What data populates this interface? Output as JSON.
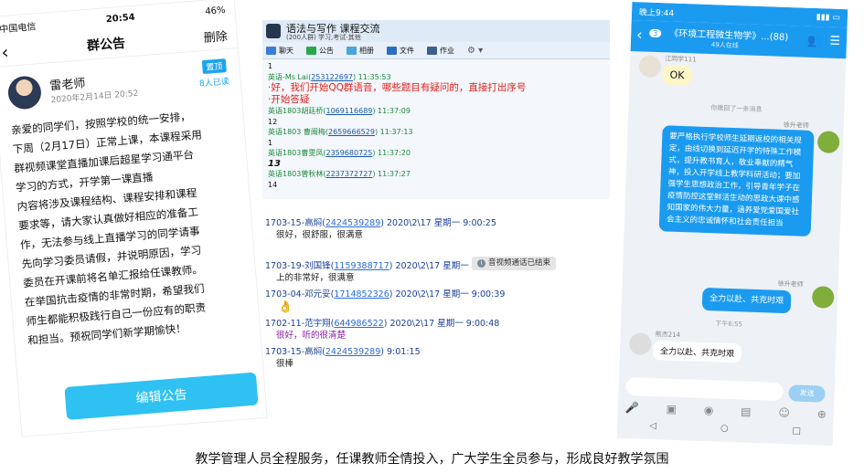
{
  "left_phone": {
    "status": {
      "carrier": "中国电信",
      "time": "20:54",
      "battery": "46%"
    },
    "header": {
      "title": "群公告",
      "delete_label": "删除"
    },
    "post": {
      "author": "雷老师",
      "date": "2020年2月14日 20:52",
      "pin_label": "置顶",
      "read_count": "8人已读",
      "lines": [
        "亲爱的同学们，按照学校的统一安排，",
        "下周（2月17日）正常上课，本课程采用",
        "群视频课堂直播加课后超星学习通平台",
        "学习的方式，开学第一课直播",
        "内容将涉及课程结构、课程安排和课程",
        "要求等，请大家认真做好相应的准备工",
        "作，无法参与线上直播学习的同学请事",
        "先向学习委员请假，并说明原因，学习",
        "委员在开课前将名单汇报给任课教师。",
        "在举国抗击疫情的非常时期，希望我们",
        "师生都能积极践行自己一份应有的职责",
        "和担当。预祝同学们新学期愉快！"
      ],
      "edit_button": "编辑公告"
    }
  },
  "qq_group": {
    "title": "语法与写作 课程交流",
    "subtitle": "(200人群) 学习,考试-其他",
    "toolbar": [
      "聊天",
      "公告",
      "相册",
      "文件",
      "作业"
    ],
    "messages": [
      {
        "type": "text",
        "text": "1"
      },
      {
        "type": "sender",
        "name": "英语-Ms Lai(",
        "id": "253122697",
        "time": ") 11:35:53"
      },
      {
        "type": "red",
        "text": "·好，我们开始QQ群语音，哪些题目有疑问的，直接打出序号"
      },
      {
        "type": "red",
        "text": "·开始答疑"
      },
      {
        "type": "sender",
        "name": "英语1803胡廷桥(",
        "id": "1069116689",
        "time": ") 11:37:09"
      },
      {
        "type": "text",
        "text": "12"
      },
      {
        "type": "sender",
        "name": "英语1803 曹闽梅(",
        "id": "2659666529",
        "time": ") 11:37:13"
      },
      {
        "type": "text",
        "text": "1"
      },
      {
        "type": "sender",
        "name": "英语1803曹雯凤(",
        "id": "2359680725",
        "time": ") 11:37:20"
      },
      {
        "type": "big",
        "text": "13"
      },
      {
        "type": "sender",
        "name": "英语1803曾秋林(",
        "id": "2237372727",
        "time": ") 11:37:27"
      },
      {
        "type": "text",
        "text": "14"
      }
    ]
  },
  "chat_log": {
    "ended_notice": "音视频通话已结束",
    "entries": [
      {
        "name": "1703-15-高焖(",
        "id": "2424539289",
        "time": ") 2020\\2\\17 星期一 9:00:25",
        "msg": "很好，很舒服，很满意",
        "style": "m"
      },
      {
        "name": "1703-19-刘国锋(",
        "id": "1159388717",
        "time": ") 2020\\2\\17 星期一 9:00:36",
        "msg": "上的非常好，很满意",
        "style": "m"
      },
      {
        "name": "1703-04-邓元妥(",
        "id": "1714852326",
        "time": ") 2020\\2\\17 星期一 9:00:39",
        "msg": "👌",
        "style": "thumb"
      },
      {
        "name": "1702-11-范宇翔(",
        "id": "644986522",
        "time": ") 2020\\2\\17 星期一 9:00:48",
        "msg": "很好，听的很清楚",
        "style": "mp"
      },
      {
        "name": "1703-15-高焖(",
        "id": "2424539289",
        "time": ") 9:01:15",
        "msg": "很棒",
        "style": "m"
      }
    ]
  },
  "right_phone": {
    "status": {
      "time": "晚上9:44"
    },
    "header": {
      "badge": "3",
      "title": "《环境工程微生物学》...(88)",
      "subtitle": "49人在线"
    },
    "sender1": "江同学111",
    "ok_text": "OK",
    "recall_notice": "你撤回了一条消息",
    "sender2": "徐升老师",
    "long_message": "要严格执行学校师生延期返校的相关规定，由线切换到延迟开学的特殊工作模式，提升教书育人，敬业奉献的精气神，投入开学线上教学科研活动；要加强学生思想政治工作，引导青年学子在疫情防控这堂鲜活生动的思政大课中感知国家的伟大力量，涵养爱党爱国爱社会主义的忠诚情怀和社会责任担当",
    "sender3": "徐升老师",
    "short_message": "全力以赴、共克时艰",
    "time_label": "下午6:55",
    "sender4": "熊杰214",
    "reply": "全力以赴、共克时艰",
    "send_label": "发送"
  },
  "caption": "教学管理人员全程服务，任课教师全情投入，广大学生全员参与，形成良好教学氛围"
}
